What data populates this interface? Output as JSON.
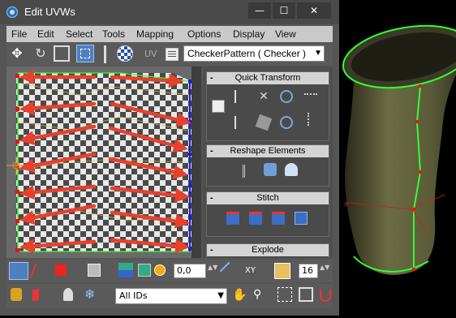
{
  "window": {
    "title": "Edit UVWs",
    "controls": {
      "minimize": "—",
      "maximize": "☐",
      "close": "✕"
    }
  },
  "menu": [
    "File",
    "Edit",
    "Select",
    "Tools",
    "Mapping",
    "Options",
    "Display",
    "View"
  ],
  "toolbar_top": {
    "uv_label": "UV",
    "texture_select": "CheckerPattern  ( Checker )",
    "icons": [
      "move-icon",
      "rotate-icon",
      "scale-icon",
      "freeform-icon",
      "mirror-icon",
      "checker-map-icon",
      "options-icon"
    ]
  },
  "panel": {
    "rollouts": [
      {
        "title": "Quick Transform",
        "collapse": "-"
      },
      {
        "title": "Reshape Elements",
        "collapse": "-"
      },
      {
        "title": "Stitch",
        "collapse": "-"
      },
      {
        "title": "Explode",
        "collapse": "-"
      }
    ]
  },
  "toolbar_bottom1": {
    "spinner_value": "0,0",
    "xy_label": "XY",
    "zoom_value": "16"
  },
  "toolbar_bottom2": {
    "id_filter": "All IDs"
  },
  "colors": {
    "arrow": "#e8402c",
    "seam_green": "#33ff33",
    "edge_blue": "#1a1ae0",
    "vertex_red": "#ee1111",
    "mesh_olive": "#5c5c3a"
  }
}
